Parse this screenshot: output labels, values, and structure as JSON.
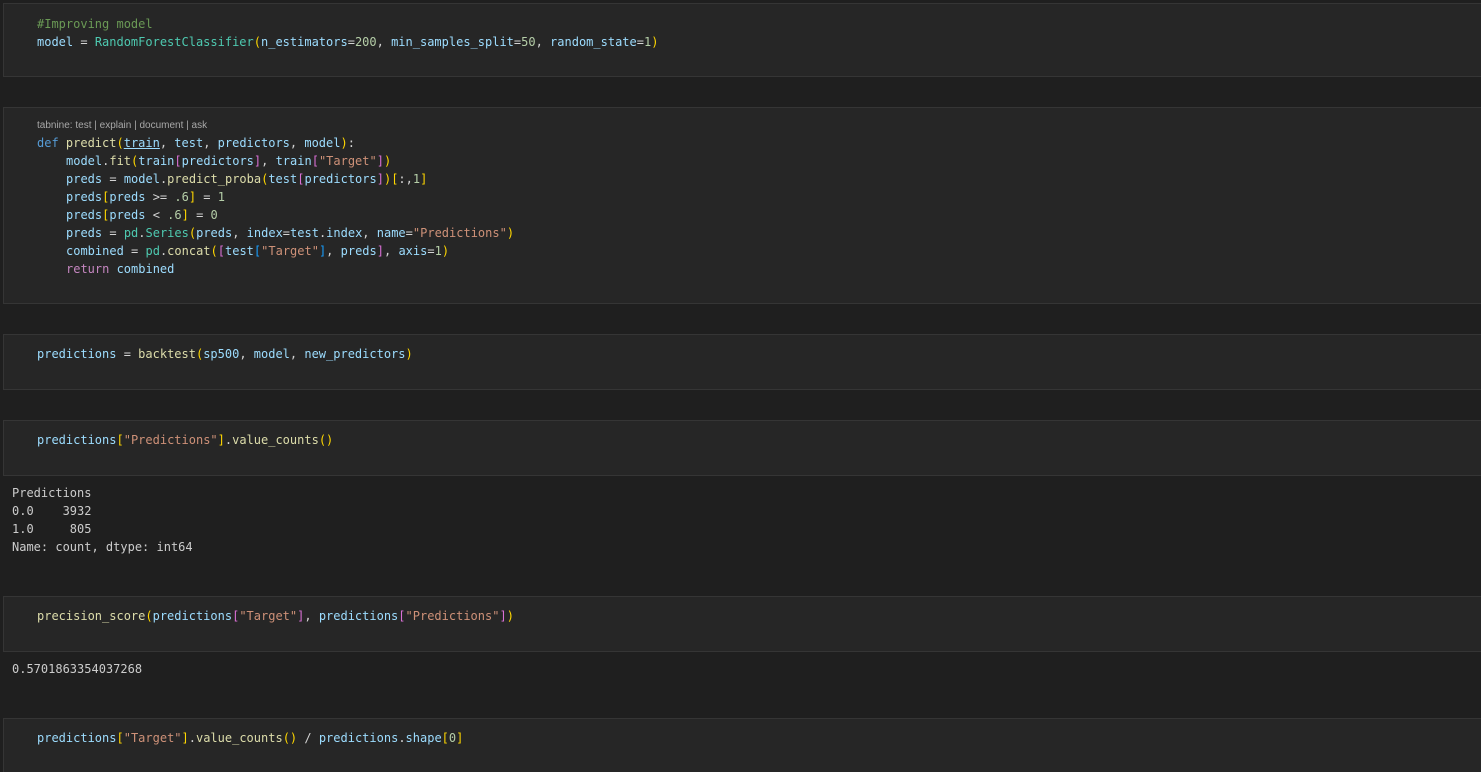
{
  "cells": [
    {
      "id": "cell-1",
      "lines": [
        [
          {
            "t": "#Improving model",
            "c": "cm"
          }
        ],
        [
          {
            "t": "model",
            "c": "v"
          },
          {
            "t": " = ",
            "c": "o"
          },
          {
            "t": "RandomForestClassifier",
            "c": "c"
          },
          {
            "t": "(",
            "c": "p1"
          },
          {
            "t": "n_estimators",
            "c": "v"
          },
          {
            "t": "=",
            "c": "o"
          },
          {
            "t": "200",
            "c": "n"
          },
          {
            "t": ", ",
            "c": "o"
          },
          {
            "t": "min_samples_split",
            "c": "v"
          },
          {
            "t": "=",
            "c": "o"
          },
          {
            "t": "50",
            "c": "n"
          },
          {
            "t": ", ",
            "c": "o"
          },
          {
            "t": "random_state",
            "c": "v"
          },
          {
            "t": "=",
            "c": "o"
          },
          {
            "t": "1",
            "c": "n"
          },
          {
            "t": ")",
            "c": "p1"
          }
        ]
      ]
    },
    {
      "id": "cell-2",
      "codelens": "tabnine: test | explain | document | ask",
      "lines": [
        [
          {
            "t": "def ",
            "c": "k"
          },
          {
            "t": "predict",
            "c": "f"
          },
          {
            "t": "(",
            "c": "p1"
          },
          {
            "t": "train",
            "c": "v u"
          },
          {
            "t": ", ",
            "c": "o"
          },
          {
            "t": "test",
            "c": "v"
          },
          {
            "t": ", ",
            "c": "o"
          },
          {
            "t": "predictors",
            "c": "v"
          },
          {
            "t": ", ",
            "c": "o"
          },
          {
            "t": "model",
            "c": "v"
          },
          {
            "t": ")",
            "c": "p1"
          },
          {
            "t": ":",
            "c": "o"
          }
        ],
        [
          {
            "indent": true
          },
          {
            "t": "model",
            "c": "v"
          },
          {
            "t": ".",
            "c": "o"
          },
          {
            "t": "fit",
            "c": "f"
          },
          {
            "t": "(",
            "c": "p1"
          },
          {
            "t": "train",
            "c": "v"
          },
          {
            "t": "[",
            "c": "p2"
          },
          {
            "t": "predictors",
            "c": "v"
          },
          {
            "t": "]",
            "c": "p2"
          },
          {
            "t": ", ",
            "c": "o"
          },
          {
            "t": "train",
            "c": "v"
          },
          {
            "t": "[",
            "c": "p2"
          },
          {
            "t": "\"Target\"",
            "c": "s"
          },
          {
            "t": "]",
            "c": "p2"
          },
          {
            "t": ")",
            "c": "p1"
          }
        ],
        [
          {
            "indent": true
          },
          {
            "t": "preds",
            "c": "v"
          },
          {
            "t": " = ",
            "c": "o"
          },
          {
            "t": "model",
            "c": "v"
          },
          {
            "t": ".",
            "c": "o"
          },
          {
            "t": "predict_proba",
            "c": "f"
          },
          {
            "t": "(",
            "c": "p1"
          },
          {
            "t": "test",
            "c": "v"
          },
          {
            "t": "[",
            "c": "p2"
          },
          {
            "t": "predictors",
            "c": "v"
          },
          {
            "t": "]",
            "c": "p2"
          },
          {
            "t": ")",
            "c": "p1"
          },
          {
            "t": "[",
            "c": "p1"
          },
          {
            "t": ":,",
            "c": "o"
          },
          {
            "t": "1",
            "c": "n"
          },
          {
            "t": "]",
            "c": "p1"
          }
        ],
        [
          {
            "indent": true
          },
          {
            "t": "preds",
            "c": "v"
          },
          {
            "t": "[",
            "c": "p1"
          },
          {
            "t": "preds",
            "c": "v"
          },
          {
            "t": " >= ",
            "c": "o"
          },
          {
            "t": ".6",
            "c": "n"
          },
          {
            "t": "]",
            "c": "p1"
          },
          {
            "t": " = ",
            "c": "o"
          },
          {
            "t": "1",
            "c": "n"
          }
        ],
        [
          {
            "indent": true
          },
          {
            "t": "preds",
            "c": "v"
          },
          {
            "t": "[",
            "c": "p1"
          },
          {
            "t": "preds",
            "c": "v"
          },
          {
            "t": " < ",
            "c": "o"
          },
          {
            "t": ".6",
            "c": "n"
          },
          {
            "t": "]",
            "c": "p1"
          },
          {
            "t": " = ",
            "c": "o"
          },
          {
            "t": "0",
            "c": "n"
          }
        ],
        [
          {
            "indent": true
          },
          {
            "t": "preds",
            "c": "v"
          },
          {
            "t": " = ",
            "c": "o"
          },
          {
            "t": "pd",
            "c": "c"
          },
          {
            "t": ".",
            "c": "o"
          },
          {
            "t": "Series",
            "c": "c"
          },
          {
            "t": "(",
            "c": "p1"
          },
          {
            "t": "preds",
            "c": "v"
          },
          {
            "t": ", ",
            "c": "o"
          },
          {
            "t": "index",
            "c": "v"
          },
          {
            "t": "=",
            "c": "o"
          },
          {
            "t": "test",
            "c": "v"
          },
          {
            "t": ".",
            "c": "o"
          },
          {
            "t": "index",
            "c": "v"
          },
          {
            "t": ", ",
            "c": "o"
          },
          {
            "t": "name",
            "c": "v"
          },
          {
            "t": "=",
            "c": "o"
          },
          {
            "t": "\"Predictions\"",
            "c": "s"
          },
          {
            "t": ")",
            "c": "p1"
          }
        ],
        [
          {
            "indent": true
          },
          {
            "t": "combined",
            "c": "v"
          },
          {
            "t": " = ",
            "c": "o"
          },
          {
            "t": "pd",
            "c": "c"
          },
          {
            "t": ".",
            "c": "o"
          },
          {
            "t": "concat",
            "c": "f"
          },
          {
            "t": "(",
            "c": "p1"
          },
          {
            "t": "[",
            "c": "p2"
          },
          {
            "t": "test",
            "c": "v"
          },
          {
            "t": "[",
            "c": "p3"
          },
          {
            "t": "\"Target\"",
            "c": "s"
          },
          {
            "t": "]",
            "c": "p3"
          },
          {
            "t": ", ",
            "c": "o"
          },
          {
            "t": "preds",
            "c": "v"
          },
          {
            "t": "]",
            "c": "p2"
          },
          {
            "t": ", ",
            "c": "o"
          },
          {
            "t": "axis",
            "c": "v"
          },
          {
            "t": "=",
            "c": "o"
          },
          {
            "t": "1",
            "c": "n"
          },
          {
            "t": ")",
            "c": "p1"
          }
        ],
        [
          {
            "indent": true
          },
          {
            "t": "return ",
            "c": "kc"
          },
          {
            "t": "combined",
            "c": "v"
          }
        ]
      ]
    },
    {
      "id": "cell-3",
      "lines": [
        [
          {
            "t": "predictions",
            "c": "v"
          },
          {
            "t": " = ",
            "c": "o"
          },
          {
            "t": "backtest",
            "c": "f"
          },
          {
            "t": "(",
            "c": "p1"
          },
          {
            "t": "sp500",
            "c": "v"
          },
          {
            "t": ", ",
            "c": "o"
          },
          {
            "t": "model",
            "c": "v"
          },
          {
            "t": ", ",
            "c": "o"
          },
          {
            "t": "new_predictors",
            "c": "v"
          },
          {
            "t": ")",
            "c": "p1"
          }
        ]
      ]
    },
    {
      "id": "cell-4",
      "lines": [
        [
          {
            "t": "predictions",
            "c": "v"
          },
          {
            "t": "[",
            "c": "p1"
          },
          {
            "t": "\"Predictions\"",
            "c": "s"
          },
          {
            "t": "]",
            "c": "p1"
          },
          {
            "t": ".",
            "c": "o"
          },
          {
            "t": "value_counts",
            "c": "f"
          },
          {
            "t": "()",
            "c": "p1"
          }
        ]
      ],
      "output": [
        "Predictions",
        "0.0    3932",
        "1.0     805",
        "Name: count, dtype: int64"
      ]
    },
    {
      "id": "cell-5",
      "lines": [
        [
          {
            "t": "precision_score",
            "c": "f"
          },
          {
            "t": "(",
            "c": "p1"
          },
          {
            "t": "predictions",
            "c": "v"
          },
          {
            "t": "[",
            "c": "p2"
          },
          {
            "t": "\"Target\"",
            "c": "s"
          },
          {
            "t": "]",
            "c": "p2"
          },
          {
            "t": ", ",
            "c": "o"
          },
          {
            "t": "predictions",
            "c": "v"
          },
          {
            "t": "[",
            "c": "p2"
          },
          {
            "t": "\"Predictions\"",
            "c": "s"
          },
          {
            "t": "]",
            "c": "p2"
          },
          {
            "t": ")",
            "c": "p1"
          }
        ]
      ],
      "output": [
        "0.5701863354037268"
      ]
    },
    {
      "id": "cell-6",
      "lines": [
        [
          {
            "t": "predictions",
            "c": "v"
          },
          {
            "t": "[",
            "c": "p1"
          },
          {
            "t": "\"Target\"",
            "c": "s"
          },
          {
            "t": "]",
            "c": "p1"
          },
          {
            "t": ".",
            "c": "o"
          },
          {
            "t": "value_counts",
            "c": "f"
          },
          {
            "t": "()",
            "c": "p1"
          },
          {
            "t": " / ",
            "c": "o"
          },
          {
            "t": "predictions",
            "c": "v"
          },
          {
            "t": ".",
            "c": "o"
          },
          {
            "t": "shape",
            "c": "v"
          },
          {
            "t": "[",
            "c": "p1"
          },
          {
            "t": "0",
            "c": "n"
          },
          {
            "t": "]",
            "c": "p1"
          }
        ]
      ]
    }
  ]
}
